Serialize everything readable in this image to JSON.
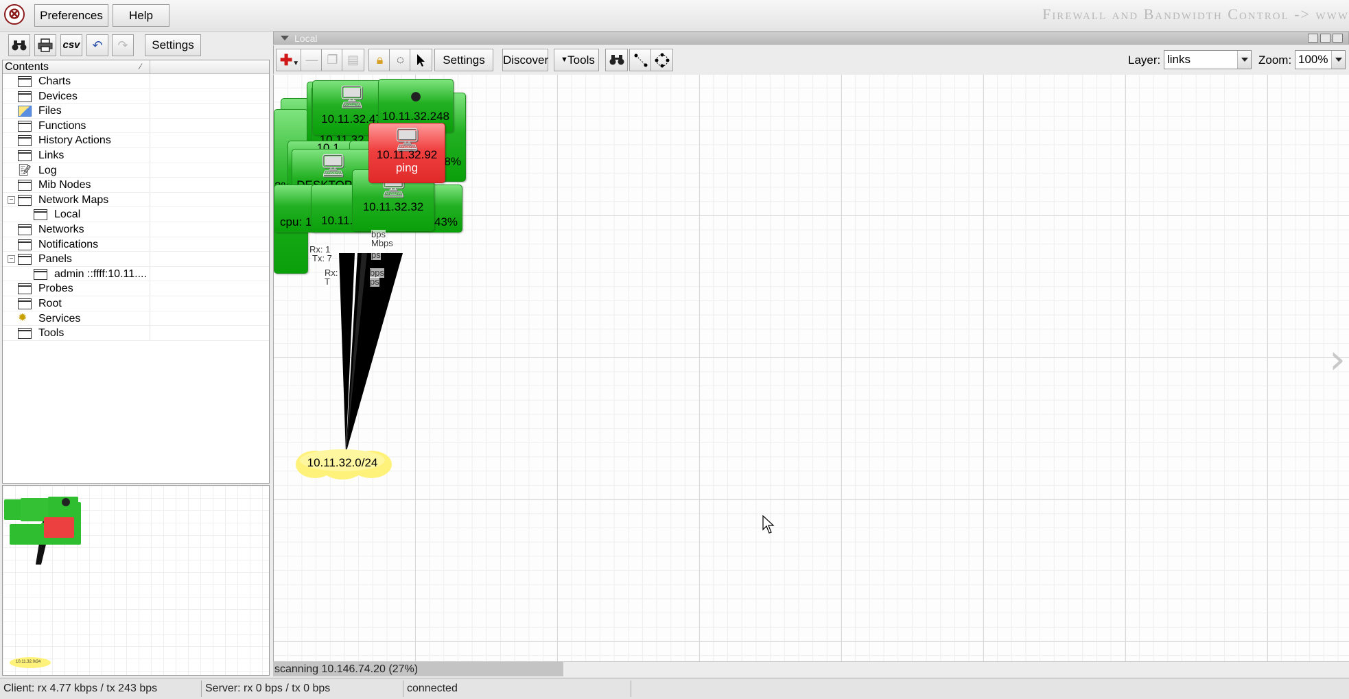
{
  "menubar": {
    "preferences_label": "Preferences",
    "help_label": "Help",
    "banner_text": "Firewall and Bandwidth Control -> www"
  },
  "left_toolbar": {
    "csv_label": "csv",
    "settings_label": "Settings"
  },
  "tree": {
    "header_label": "Contents",
    "items": [
      {
        "label": "Charts",
        "icon": "window-icon"
      },
      {
        "label": "Devices",
        "icon": "window-icon"
      },
      {
        "label": "Files",
        "icon": "files-icon"
      },
      {
        "label": "Functions",
        "icon": "window-icon"
      },
      {
        "label": "History Actions",
        "icon": "window-icon"
      },
      {
        "label": "Links",
        "icon": "window-icon"
      },
      {
        "label": "Log",
        "icon": "log-icon"
      },
      {
        "label": "Mib Nodes",
        "icon": "window-icon"
      },
      {
        "label": "Network Maps",
        "icon": "window-icon",
        "expanded": true
      },
      {
        "label": "Local",
        "icon": "window-icon",
        "child": true
      },
      {
        "label": "Networks",
        "icon": "window-icon"
      },
      {
        "label": "Notifications",
        "icon": "window-icon"
      },
      {
        "label": "Panels",
        "icon": "window-icon",
        "expanded": true
      },
      {
        "label": "admin ::ffff:10.11....",
        "icon": "window-icon",
        "child": true
      },
      {
        "label": "Probes",
        "icon": "window-icon"
      },
      {
        "label": "Root",
        "icon": "window-icon"
      },
      {
        "label": "Services",
        "icon": "services-icon"
      },
      {
        "label": "Tools",
        "icon": "window-icon"
      }
    ]
  },
  "main": {
    "title": "Local",
    "toolbar": {
      "settings_label": "Settings",
      "discover_label": "Discover",
      "tools_label": "Tools",
      "layer_label": "Layer:",
      "layer_value": "links",
      "zoom_label": "Zoom:",
      "zoom_value": "100%"
    }
  },
  "map": {
    "nodes": {
      "n1_label": "10.11.32.47",
      "n1_sub": "10.11.32.110",
      "n2_label": "10.11.32.248",
      "n2_disk": "k: 98%",
      "n3_label": "10.11.32.92",
      "n3_sub": "ping",
      "n4_label": "DESKTOP-57",
      "n4_cpu": "cpu: 1.",
      "n4_left": "2% r",
      "n5_label": "10.11.32.",
      "n6_label": "10.11.32.32",
      "n6_disk": "disk: 43%",
      "n7_label": "10",
      "n8_label": "10.1"
    },
    "link_labels": {
      "rx1": "Rx: 1",
      "tx1": "Tx: 7",
      "bps1": "bps",
      "mbps1": "Mbps",
      "bps2": "ps",
      "rx2": "Rx:",
      "tx2": "T",
      "bps3": "bps",
      "bps4": "ps"
    },
    "subnet_label": "10.11.32.0/24"
  },
  "minimap": {
    "subnet_label": "10.11.32.0/24"
  },
  "scan": {
    "text": "scanning 10.146.74.20 (27%)",
    "progress_percent": 27
  },
  "status": {
    "client": "Client: rx 4.77 kbps / tx 243 bps",
    "server": "Server: rx 0 bps / tx 0 bps",
    "connection": "connected"
  },
  "colors": {
    "node_ok": "#22b022",
    "node_down": "#f04040",
    "subnet": "#fff27a"
  }
}
